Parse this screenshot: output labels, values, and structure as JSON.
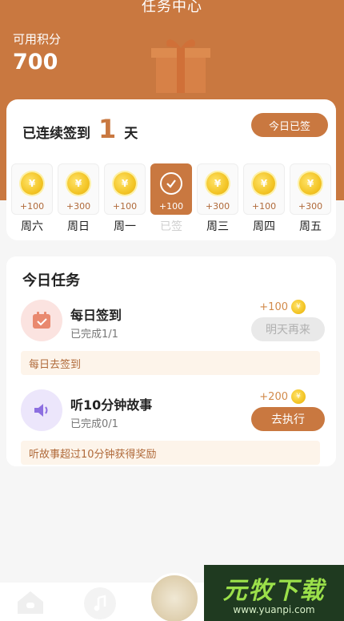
{
  "header": {
    "title": "任务中心",
    "points_label": "可用积分",
    "points_value": "700"
  },
  "signin": {
    "streak_prefix": "已连续签到",
    "streak_days": "1",
    "streak_suffix": "天",
    "today_button": "今日已签",
    "days": [
      {
        "points": "+100",
        "name": "周六",
        "checked": false
      },
      {
        "points": "+300",
        "name": "周日",
        "checked": false
      },
      {
        "points": "+100",
        "name": "周一",
        "checked": false
      },
      {
        "points": "+100",
        "name": "已签",
        "checked": true
      },
      {
        "points": "+300",
        "name": "周三",
        "checked": false
      },
      {
        "points": "+100",
        "name": "周四",
        "checked": false
      },
      {
        "points": "+300",
        "name": "周五",
        "checked": false
      }
    ]
  },
  "tasks": {
    "title": "今日任务",
    "items": [
      {
        "name": "每日签到",
        "status": "已完成1/1",
        "reward": "+100",
        "button": "明天再来",
        "hint": "每日去签到"
      },
      {
        "name": "听10分钟故事",
        "status": "已完成0/1",
        "reward": "+200",
        "button": "去执行",
        "hint": "听故事超过10分钟获得奖励"
      }
    ]
  },
  "watermark": {
    "main": "元牧下载",
    "sub": "www.yuanpi.com"
  },
  "colors": {
    "accent": "#c97840",
    "coin": "#f3c526"
  }
}
